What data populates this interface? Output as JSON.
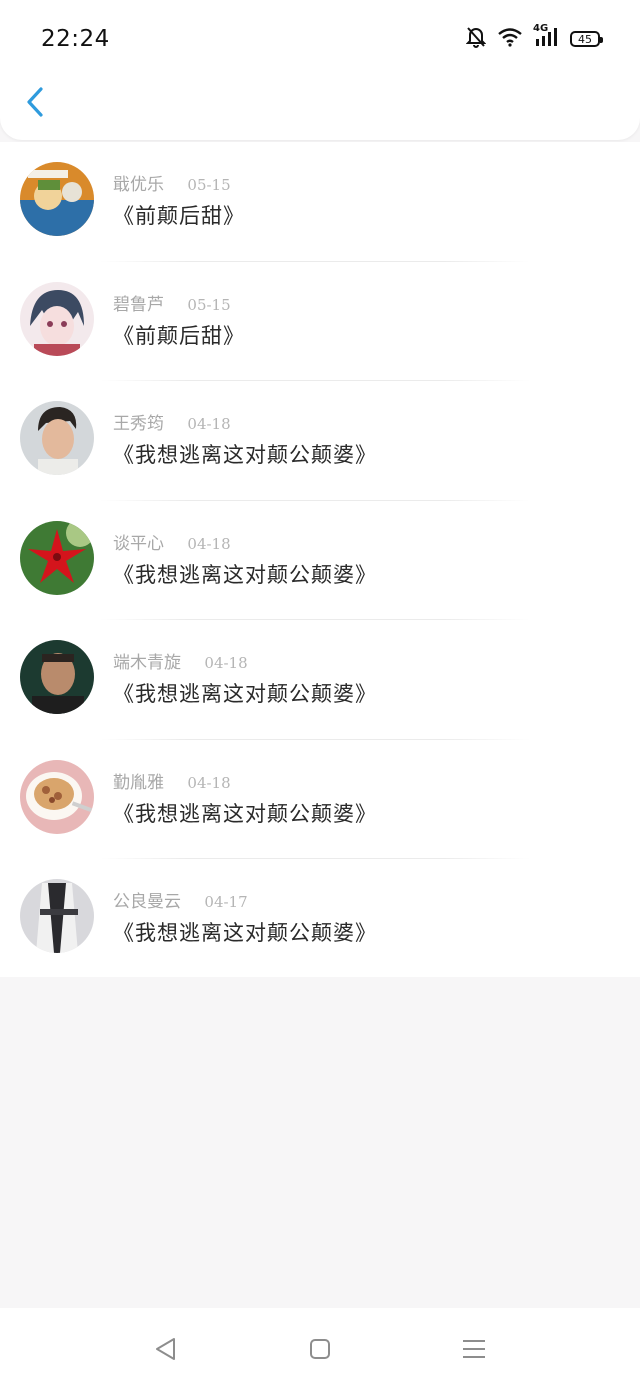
{
  "status_bar": {
    "time": "22:24",
    "network": "4G",
    "battery": "45",
    "icons": [
      "bell-off-icon",
      "wifi-icon",
      "signal-icon",
      "battery-icon"
    ]
  },
  "header": {
    "back_icon": "chevron-left-icon",
    "accent": "#2f9bdd"
  },
  "comments": [
    {
      "user": "戢优乐",
      "date": "05-15",
      "content": "《前颠后甜》"
    },
    {
      "user": "碧鲁芦",
      "date": "05-15",
      "content": "《前颠后甜》"
    },
    {
      "user": "王秀筠",
      "date": "04-18",
      "content": "《我想逃离这对颠公颠婆》"
    },
    {
      "user": "谈平心",
      "date": "04-18",
      "content": "《我想逃离这对颠公颠婆》"
    },
    {
      "user": "端木青旋",
      "date": "04-18",
      "content": "《我想逃离这对颠公颠婆》"
    },
    {
      "user": "勤胤雅",
      "date": "04-18",
      "content": "《我想逃离这对颠公颠婆》"
    },
    {
      "user": "公良曼云",
      "date": "04-17",
      "content": "《我想逃离这对颠公颠婆》"
    }
  ],
  "nav_bar": {
    "icons": [
      "back-triangle-icon",
      "home-square-icon",
      "menu-lines-icon"
    ]
  }
}
